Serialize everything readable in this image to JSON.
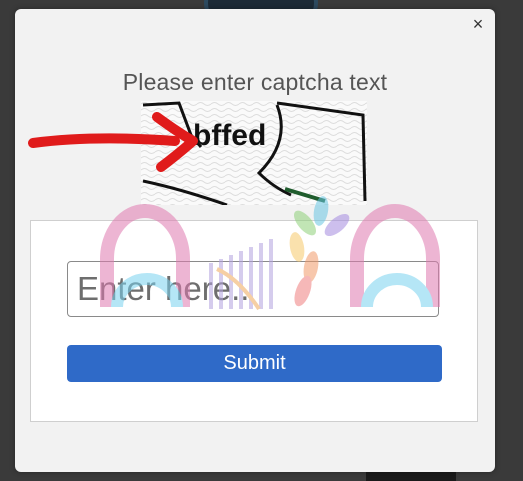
{
  "dialog": {
    "close_label": "×",
    "title": "Please enter captcha text",
    "captcha": {
      "text": "bffed"
    },
    "input": {
      "placeholder": "Enter here..",
      "value": ""
    },
    "submit_label": "Submit"
  },
  "colors": {
    "submit_button": "#2f6ac8",
    "arrow_annotation": "#e01b1b",
    "modal_background": "#f2f2f2"
  }
}
